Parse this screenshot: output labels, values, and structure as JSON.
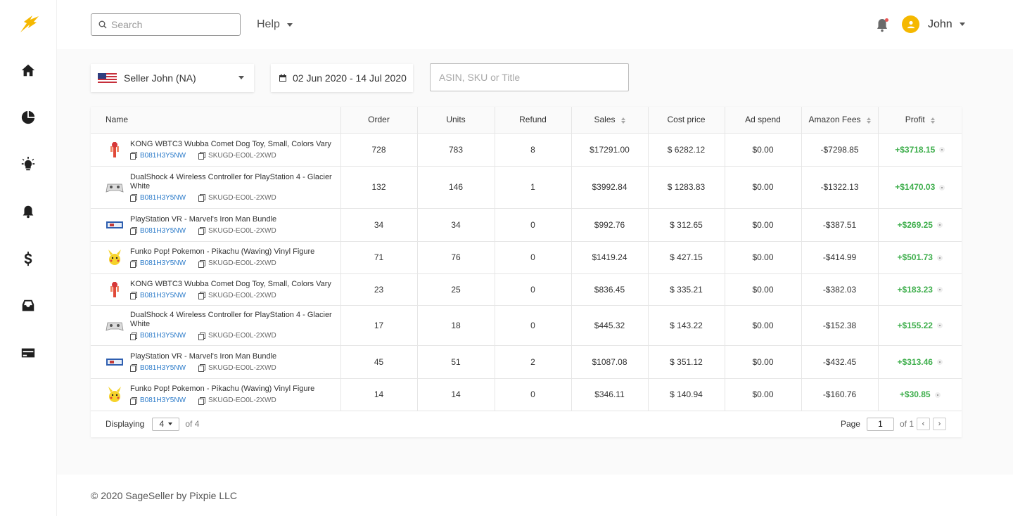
{
  "header": {
    "search_placeholder": "Search",
    "help_label": "Help",
    "user_name": "John"
  },
  "filters": {
    "seller": "Seller John (NA)",
    "date_range": "02 Jun 2020 - 14 Jul 2020",
    "asin_placeholder": "ASIN, SKU or Title"
  },
  "table": {
    "columns": [
      "Name",
      "Order",
      "Units",
      "Refund",
      "Sales",
      "Cost price",
      "Ad spend",
      "Amazon Fees",
      "Profit"
    ],
    "rows": [
      {
        "title": "KONG WBTC3 Wubba Comet Dog Toy, Small, Colors Vary",
        "asin": "B081H3Y5NW",
        "sku": "SKUGD-EO0L-2XWD",
        "order": "728",
        "units": "783",
        "refund": "8",
        "sales": "$17291.00",
        "cost": "$ 6282.12",
        "ad": "$0.00",
        "fees": "-$7298.85",
        "profit": "+$3718.15",
        "thumb": "dog-toy"
      },
      {
        "title": "DualShock 4 Wireless Controller for PlayStation 4 - Glacier White",
        "asin": "B081H3Y5NW",
        "sku": "SKUGD-EO0L-2XWD",
        "order": "132",
        "units": "146",
        "refund": "1",
        "sales": "$3992.84",
        "cost": "$ 1283.83",
        "ad": "$0.00",
        "fees": "-$1322.13",
        "profit": "+$1470.03",
        "thumb": "controller"
      },
      {
        "title": "PlayStation VR - Marvel's Iron Man Bundle",
        "asin": "B081H3Y5NW",
        "sku": "SKUGD-EO0L-2XWD",
        "order": "34",
        "units": "34",
        "refund": "0",
        "sales": "$992.76",
        "cost": "$ 312.65",
        "ad": "$0.00",
        "fees": "-$387.51",
        "profit": "+$269.25",
        "thumb": "vr"
      },
      {
        "title": "Funko Pop! Pokemon - Pikachu (Waving) Vinyl Figure",
        "asin": "B081H3Y5NW",
        "sku": "SKUGD-EO0L-2XWD",
        "order": "71",
        "units": "76",
        "refund": "0",
        "sales": "$1419.24",
        "cost": "$ 427.15",
        "ad": "$0.00",
        "fees": "-$414.99",
        "profit": "+$501.73",
        "thumb": "pikachu"
      },
      {
        "title": "KONG WBTC3 Wubba Comet Dog Toy, Small, Colors Vary",
        "asin": "B081H3Y5NW",
        "sku": "SKUGD-EO0L-2XWD",
        "order": "23",
        "units": "25",
        "refund": "0",
        "sales": "$836.45",
        "cost": "$ 335.21",
        "ad": "$0.00",
        "fees": "-$382.03",
        "profit": "+$183.23",
        "thumb": "dog-toy"
      },
      {
        "title": "DualShock 4 Wireless Controller for PlayStation 4 - Glacier White",
        "asin": "B081H3Y5NW",
        "sku": "SKUGD-EO0L-2XWD",
        "order": "17",
        "units": "18",
        "refund": "0",
        "sales": "$445.32",
        "cost": "$ 143.22",
        "ad": "$0.00",
        "fees": "-$152.38",
        "profit": "+$155.22",
        "thumb": "controller"
      },
      {
        "title": "PlayStation VR - Marvel's Iron Man Bundle",
        "asin": "B081H3Y5NW",
        "sku": "SKUGD-EO0L-2XWD",
        "order": "45",
        "units": "51",
        "refund": "2",
        "sales": "$1087.08",
        "cost": "$ 351.12",
        "ad": "$0.00",
        "fees": "-$432.45",
        "profit": "+$313.46",
        "thumb": "vr"
      },
      {
        "title": "Funko Pop! Pokemon - Pikachu (Waving) Vinyl Figure",
        "asin": "B081H3Y5NW",
        "sku": "SKUGD-EO0L-2XWD",
        "order": "14",
        "units": "14",
        "refund": "0",
        "sales": "$346.11",
        "cost": "$ 140.94",
        "ad": "$0.00",
        "fees": "-$160.76",
        "profit": "+$30.85",
        "thumb": "pikachu"
      }
    ]
  },
  "pagination": {
    "displaying_label": "Displaying",
    "per_page": "4",
    "of_total": "of 4",
    "page_label": "Page",
    "page_value": "1",
    "page_of": "of 1",
    "prev": "‹",
    "next": "›"
  },
  "footer": {
    "copyright": "© 2020 SageSeller by Pixpie LLC"
  },
  "colors": {
    "accent": "#f5b800",
    "profit": "#3dae4b",
    "link": "#2a7ac9"
  }
}
